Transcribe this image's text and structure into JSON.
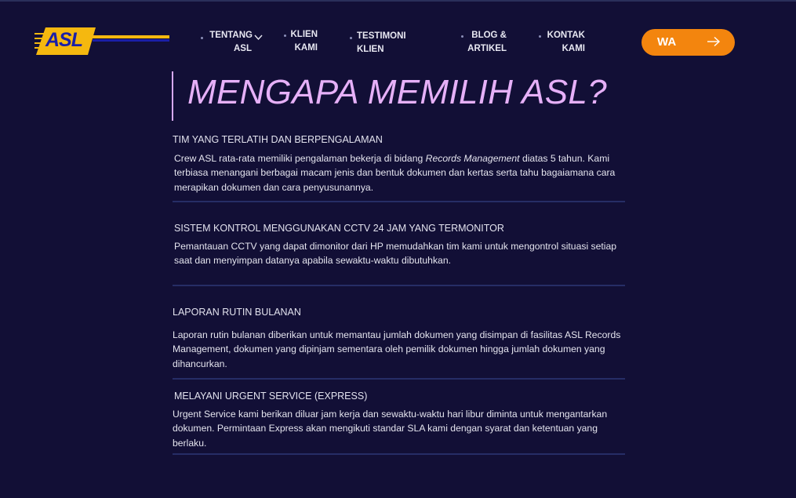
{
  "brand": {
    "logo_text": "ASL"
  },
  "nav": {
    "items": [
      {
        "label_line1": "TENTANG",
        "label_line2": "ASL"
      },
      {
        "label_line1": "KLIEN",
        "label_line2": "KAMI"
      },
      {
        "label_line1": "TESTIMONI KLIEN",
        "label_line2": ""
      },
      {
        "label_line1": "BLOG &",
        "label_line2": "ARTIKEL"
      },
      {
        "label_line1": "KONTAK",
        "label_line2": "KAMI"
      }
    ],
    "cta_label": "WA"
  },
  "heading": "MENGAPA MEMILIH ASL?",
  "features": [
    {
      "title": "TIM YANG TERLATIH DAN BERPENGALAMAN",
      "body_a": "Crew ASL rata-rata memiliki pengalaman bekerja di bidang ",
      "body_em": "Records Management",
      "body_b": " diatas 5 tahun. Kami terbiasa menangani berbagai macam jenis dan bentuk dokumen dan kertas serta tahu bagaiamana cara merapikan dokumen dan cara penyusunannya."
    },
    {
      "title": "SISTEM KONTROL MENGGUNAKAN CCTV 24 JAM YANG TERMONITOR",
      "body": "Pemantauan CCTV yang dapat dimonitor dari HP memudahkan tim kami untuk mengontrol situasi setiap saat dan menyimpan datanya apabila sewaktu-waktu dibutuhkan."
    },
    {
      "title": "LAPORAN RUTIN BULANAN",
      "body": "Laporan rutin bulanan diberikan untuk memantau jumlah dokumen yang disimpan di fasilitas ASL Records Management, dokumen yang dipinjam sementara oleh pemilik dokumen hingga jumlah dokumen yang dihancurkan."
    },
    {
      "title": "MELAYANI URGENT SERVICE (EXPRESS)",
      "body": "Urgent Service kami berikan diluar jam kerja dan sewaktu-waktu hari libur diminta untuk mengantarkan dokumen. Permintaan Express akan mengikuti standar SLA kami dengan syarat dan ketentuan yang berlaku."
    }
  ],
  "colors": {
    "background": "#120f36",
    "accent_orange": "#f3850e",
    "heading_pink": "#e6b0f8",
    "logo_blue": "#1a1fa8",
    "logo_yellow": "#f5b80f"
  }
}
